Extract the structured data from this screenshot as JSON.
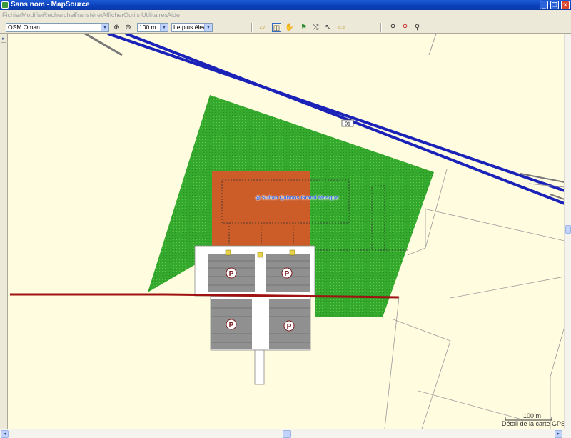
{
  "window": {
    "title": "Sans nom - MapSource",
    "minimize": "_",
    "restore": "❐",
    "close": "✕"
  },
  "menu": [
    "Fichier",
    "Modifier",
    "Rechercher",
    "Transférer",
    "Afficher",
    "Outils",
    "Utilitaires",
    "Aide"
  ],
  "toolbar": {
    "map_product": "OSM Oman",
    "zoom_level": "100 m",
    "detail_level": "Le plus élevé",
    "dropdown_arrow": "▼",
    "icons": {
      "zoom_in": "⊕",
      "zoom_out": "⊖",
      "select_map": "▱",
      "zoom_tool": "◫",
      "hand_tool": "✋",
      "waypoint_tool": "⚑",
      "route_tool": "⤮",
      "selection_tool": "↖",
      "distance_tool": "▭",
      "find": "⚲",
      "find_address": "⚲",
      "find_nearby": "⚲"
    }
  },
  "map": {
    "poi_label": "Sultan Qaboos Grand Mosque",
    "road_shield": "01",
    "parking_symbol": "P",
    "scale": "100 m",
    "detail_caption": "Détail de la carte GPS"
  },
  "scrollbars": {
    "left_arrow": "◂",
    "right_arrow": "▸",
    "side_tab": "▸"
  }
}
